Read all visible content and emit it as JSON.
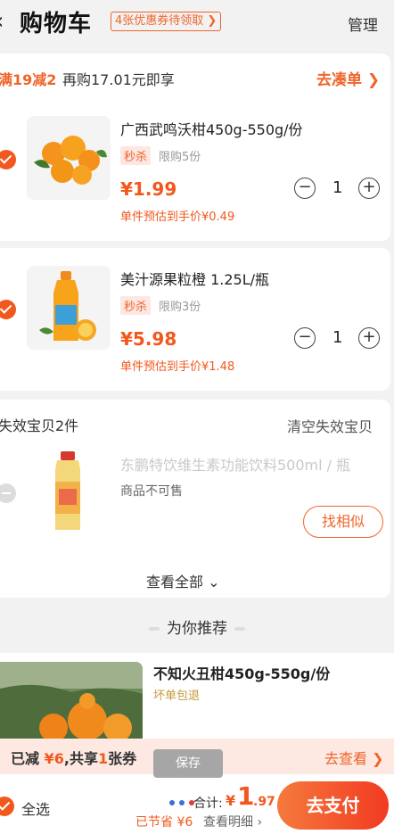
{
  "header": {
    "back": "‹",
    "title": "购物车",
    "coupon_pill": "4张优惠券待领取 ❯",
    "manage": "管理"
  },
  "promo": {
    "tag": "满19减2",
    "text": "再购17.01元即享",
    "link": "去凑单 ❯"
  },
  "items": [
    {
      "name": "广西武鸣沃柑450g-550g/份",
      "badge": "秒杀",
      "limit": "限购5份",
      "price": "¥1.99",
      "estimate": "单件预估到手价¥0.49",
      "quantity": "1",
      "minus": "−",
      "plus": "+"
    },
    {
      "name": "美汁源果粒橙 1.25L/瓶",
      "badge": "秒杀",
      "limit": "限购3份",
      "price": "¥5.98",
      "estimate": "单件预估到手价¥1.48",
      "quantity": "1",
      "minus": "−",
      "plus": "+"
    }
  ],
  "invalid": {
    "title": "失效宝贝2件",
    "clear": "清空失效宝贝",
    "item_name": "东鹏特饮维生素功能饮料500ml / 瓶",
    "status": "商品不可售",
    "find_similar": "找相似",
    "view_all": "查看全部 ⌄"
  },
  "recommend": {
    "title": "为你推荐",
    "item_name": "不知火丑柑450g-550g/份",
    "item_tag": "坏单包退"
  },
  "discount_bar": {
    "prefix": "已减",
    "amount": "¥6",
    "middle": ",共享",
    "count": "1",
    "suffix": "张券",
    "link": "去查看 ❯"
  },
  "tooltip": "保存",
  "bottom": {
    "select_all": "全选",
    "total_label": "合计:",
    "currency": "¥",
    "total_int": "1",
    "total_dec": ".97",
    "saved": "已节省 ¥6",
    "detail": "查看明细 ›",
    "pay": "去支付"
  },
  "colors": {
    "accent": "#f2581e",
    "accent_light": "#fde9e2",
    "background": "#f2f2f2"
  }
}
